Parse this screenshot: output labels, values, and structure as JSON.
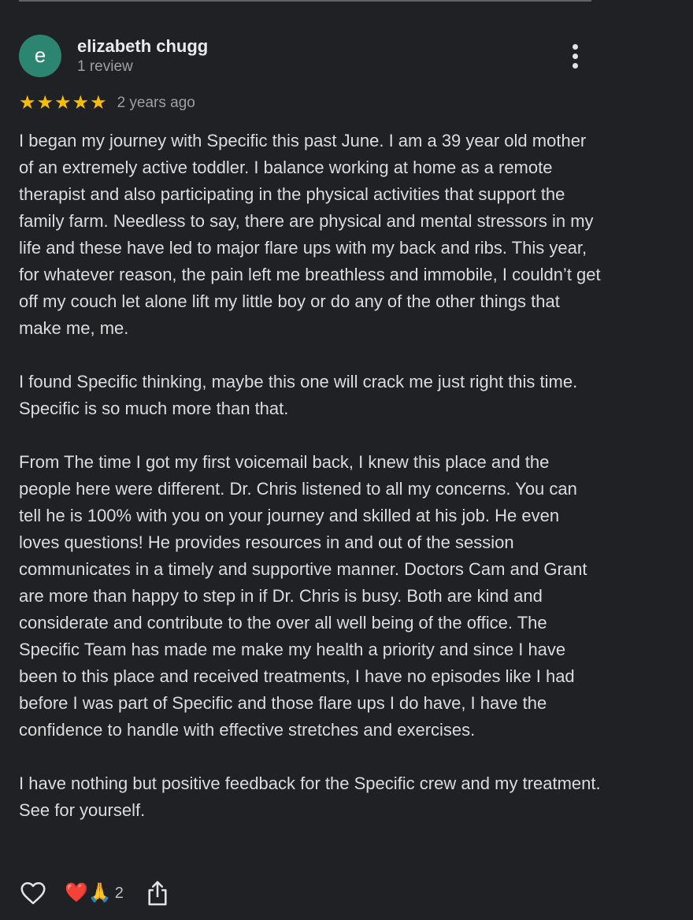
{
  "review": {
    "avatar_letter": "e",
    "avatar_color": "#2c8571",
    "reviewer_name": "elizabeth chugg",
    "review_count": "1 review",
    "rating": 5,
    "rating_max": 5,
    "star_color": "#fbbc04",
    "date": "2 years ago",
    "paragraphs": [
      "I began my journey with Specific this past June. I am a 39 year old mother of an extremely active toddler. I balance working at home as a remote therapist and also participating in the physical activities that support the family farm. Needless to say, there are physical and mental stressors in my life and these have led to major flare ups with my back and ribs. This year, for whatever reason, the pain left me breathless and immobile, I couldn’t get off my couch let alone lift my little boy or do any of the other things that make me, me.",
      "I found Specific thinking, maybe this one will crack me just right this time. Specific is so much more than that.",
      "From The time I got my first voicemail back, I knew this place and the people here were different. Dr. Chris listened to all my concerns. You can tell he is 100% with you on your journey and skilled at his job. He even loves questions! He provides resources in and out of the session communicates in a timely and supportive manner. Doctors Cam and Grant are more than happy to step in if Dr. Chris is busy. Both are kind and considerate and contribute to the over all well being of the office. The Specific Team has made me make my health a priority and since I have been to this place and received treatments, I have no episodes like I had before I was part of Specific and those flare ups I do have, I have the confidence to handle with effective stretches and exercises.",
      "I have nothing but positive feedback for the Specific crew and my treatment. See for yourself."
    ]
  },
  "actions": {
    "like_icon": "heart-outline-icon",
    "reaction_emojis": "❤️🙏",
    "reaction_count": "2",
    "share_icon": "share-icon",
    "more_icon": "more-vert-icon"
  }
}
